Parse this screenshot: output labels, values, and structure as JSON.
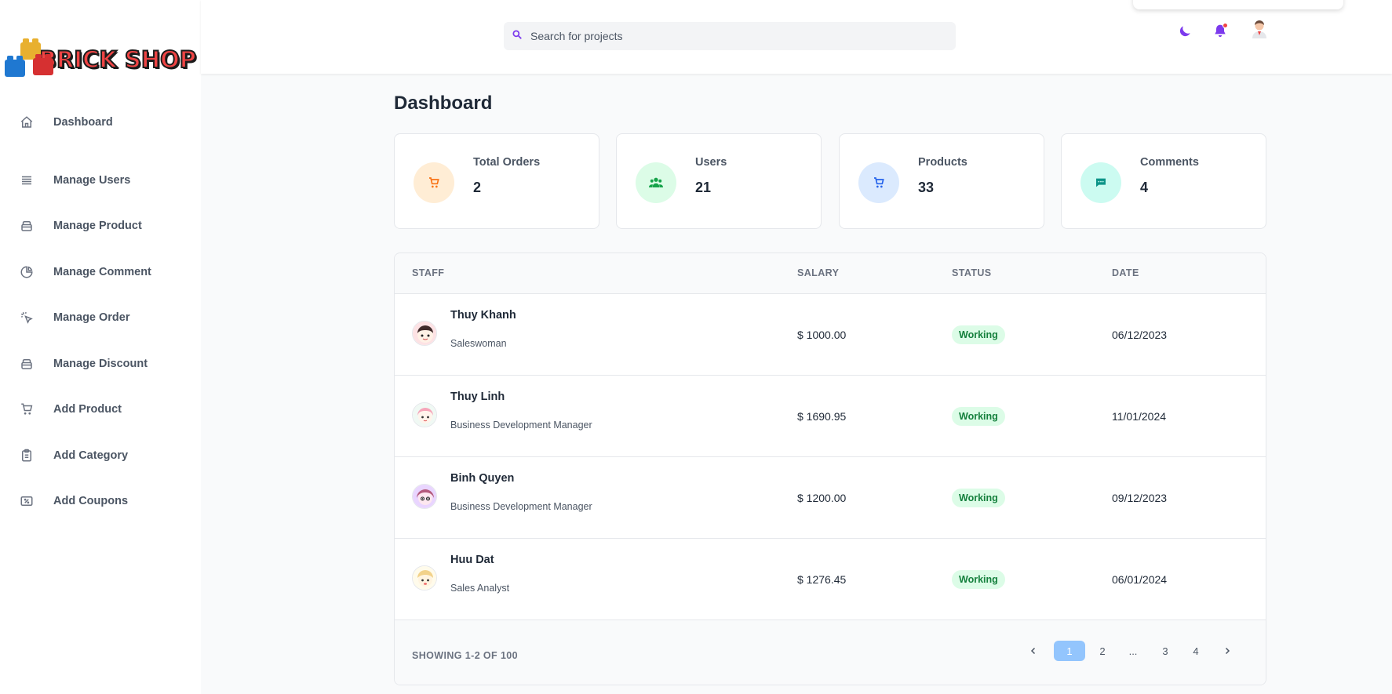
{
  "brand": {
    "name": "BRICK SHOP"
  },
  "sidebar": {
    "items": [
      {
        "label": "Dashboard",
        "icon": "home-icon"
      },
      {
        "label": "Manage Users",
        "icon": "list-icon"
      },
      {
        "label": "Manage Product",
        "icon": "box-icon"
      },
      {
        "label": "Manage Comment",
        "icon": "pie-chart-icon"
      },
      {
        "label": "Manage Order",
        "icon": "cursor-click-icon"
      },
      {
        "label": "Manage Discount",
        "icon": "box-icon"
      },
      {
        "label": "Add Product",
        "icon": "cart-icon"
      },
      {
        "label": "Add Category",
        "icon": "clipboard-icon"
      },
      {
        "label": "Add Coupons",
        "icon": "percent-tag-icon"
      }
    ]
  },
  "header": {
    "search": {
      "placeholder": "Search for projects"
    },
    "icons": [
      "moon-icon",
      "bell-icon",
      "user-avatar-icon"
    ]
  },
  "page": {
    "title": "Dashboard"
  },
  "stats": [
    {
      "label": "Total Orders",
      "value": "2",
      "icon": "cart-icon",
      "color": "#f97316",
      "bg": "#ffedd5"
    },
    {
      "label": "Users",
      "value": "21",
      "icon": "users-icon",
      "color": "#16a34a",
      "bg": "#dcfce7"
    },
    {
      "label": "Products",
      "value": "33",
      "icon": "cart-icon",
      "color": "#2563eb",
      "bg": "#dbeafe"
    },
    {
      "label": "Comments",
      "value": "4",
      "icon": "chat-icon",
      "color": "#0d9488",
      "bg": "#ccfbf1"
    }
  ],
  "table": {
    "columns": [
      "STAFF",
      "SALARY",
      "STATUS",
      "DATE"
    ],
    "rows": [
      {
        "name": "Thuy Khanh",
        "role": "Saleswoman",
        "salary": "$ 1000.00",
        "status": "Working",
        "date": "06/12/2023"
      },
      {
        "name": "Thuy Linh",
        "role": "Business Development Manager",
        "salary": "$ 1690.95",
        "status": "Working",
        "date": "11/01/2024"
      },
      {
        "name": "Binh Quyen",
        "role": "Business Development Manager",
        "salary": "$ 1200.00",
        "status": "Working",
        "date": "09/12/2023"
      },
      {
        "name": "Huu Dat",
        "role": "Sales Analyst",
        "salary": "$ 1276.45",
        "status": "Working",
        "date": "06/01/2024"
      }
    ],
    "footer": {
      "showing": "SHOWING 1-2 OF 100",
      "pages": [
        "1",
        "2",
        "...",
        "3",
        "4"
      ],
      "active_page": "1",
      "prev": "‹",
      "next": "›"
    }
  },
  "colors": {
    "accent": "#7c3aed",
    "status_bg": "#dcfce7",
    "status_text": "#15803d",
    "active_page": "#93c5fd"
  }
}
